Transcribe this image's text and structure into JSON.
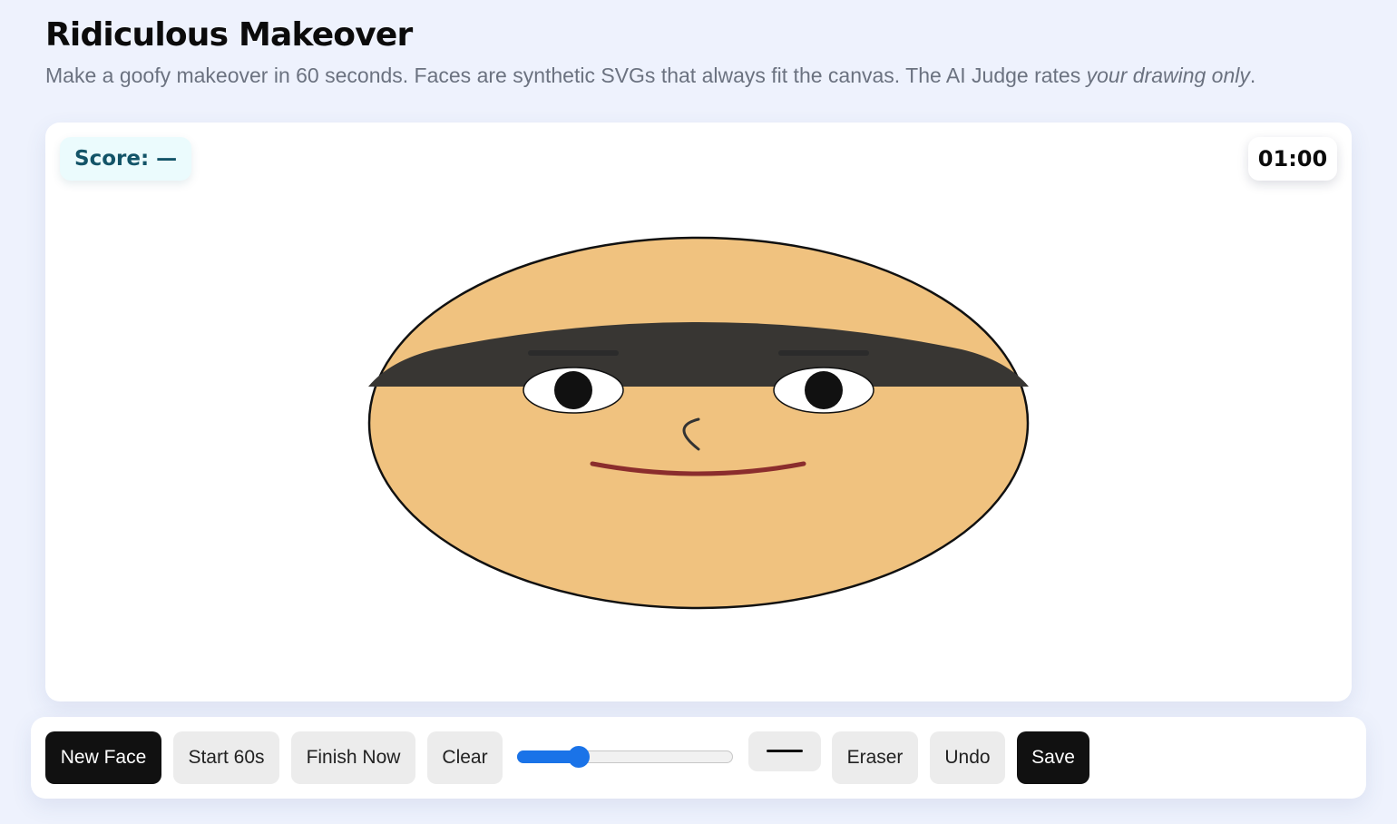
{
  "header": {
    "title": "Ridiculous Makeover",
    "subtitle_main": "Make a goofy makeover in 60 seconds. Faces are synthetic SVGs that always fit the canvas. The AI Judge rates ",
    "subtitle_emphasis": "your drawing only",
    "subtitle_end": "."
  },
  "stage": {
    "score_label": "Score:",
    "score_value": "—",
    "timer": "01:00"
  },
  "face": {
    "skin_color": "#f0c27f",
    "outline_color": "#111111",
    "hair_color": "#383633",
    "eye_white": "#ffffff",
    "pupil_color": "#111111",
    "brow_color": "#2b2b2b",
    "nose_color": "#333333",
    "mouth_color": "#8b2d2d"
  },
  "toolbar": {
    "new_face_label": "New Face",
    "start_label": "Start 60s",
    "finish_label": "Finish Now",
    "clear_label": "Clear",
    "brush_size_fraction": 0.26,
    "brush_color": "#111111",
    "eraser_label": "Eraser",
    "undo_label": "Undo",
    "save_label": "Save",
    "accent_color": "#1a73e8"
  }
}
